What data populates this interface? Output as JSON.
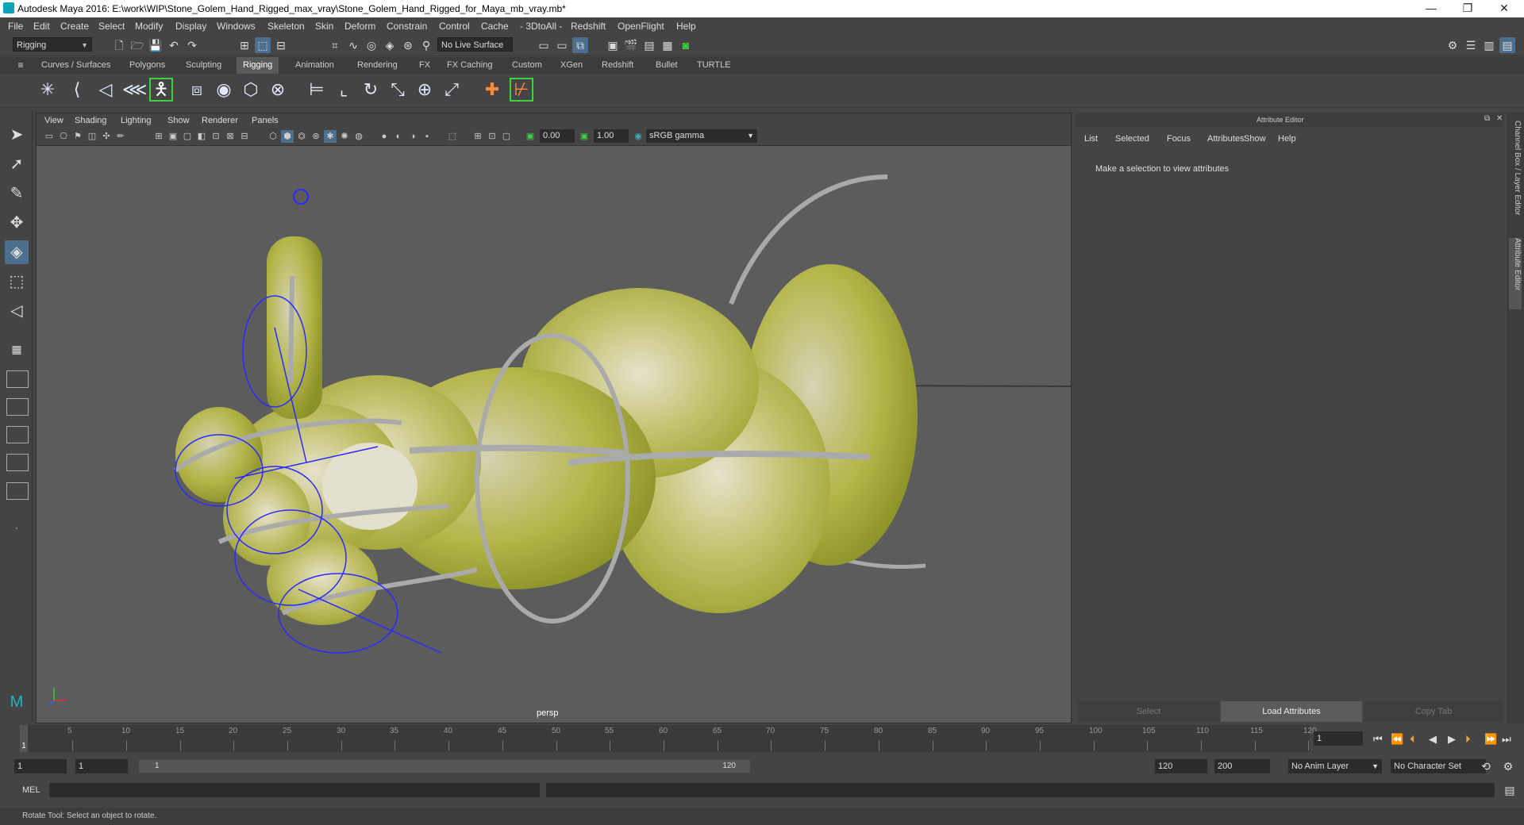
{
  "window": {
    "title": "Autodesk Maya 2016: E:\\work\\WIP\\Stone_Golem_Hand_Rigged_max_vray\\Stone_Golem_Hand_Rigged_for_Maya_mb_vray.mb*",
    "min": "—",
    "max": "❐",
    "close": "✕"
  },
  "menus": [
    "File",
    "Edit",
    "Create",
    "Select",
    "Modify",
    "Display",
    "Windows",
    "Skeleton",
    "Skin",
    "Deform",
    "Constrain",
    "Control",
    "Cache",
    "- 3DtoAll -",
    "Redshift",
    "OpenFlight",
    "Help"
  ],
  "status": {
    "menuset": "Rigging",
    "live_surface": "No Live Surface"
  },
  "shelf_tabs": [
    "Curves / Surfaces",
    "Polygons",
    "Sculpting",
    "Rigging",
    "Animation",
    "Rendering",
    "FX",
    "FX Caching",
    "Custom",
    "XGen",
    "Redshift",
    "Bullet",
    "TURTLE"
  ],
  "shelf_active": "Rigging",
  "viewport": {
    "menus": [
      "View",
      "Shading",
      "Lighting",
      "Show",
      "Renderer",
      "Panels"
    ],
    "exposure": "0.00",
    "gamma": "1.00",
    "color_space": "sRGB gamma",
    "camera_label": "persp"
  },
  "attribute_editor": {
    "title": "Attribute Editor",
    "menus": [
      "List",
      "Selected",
      "Focus",
      "Attributes",
      "Show",
      "Help"
    ],
    "message": "Make a selection to view attributes",
    "buttons": [
      "Select",
      "Load Attributes",
      "Copy Tab"
    ]
  },
  "side_tabs": [
    "Channel Box / Layer Editor",
    "Attribute Editor"
  ],
  "timeline": {
    "ticks": [
      "5",
      "10",
      "15",
      "20",
      "25",
      "30",
      "35",
      "40",
      "45",
      "50",
      "55",
      "60",
      "65",
      "70",
      "75",
      "80",
      "85",
      "90",
      "95",
      "100",
      "105",
      "110",
      "115",
      "120"
    ],
    "current_frame_marker": "1",
    "current_frame_field": "1"
  },
  "range": {
    "start": "1",
    "inner_start": "1",
    "bar_start": "1",
    "bar_end": "120",
    "end": "120",
    "outer_end": "200",
    "anim_layer": "No Anim Layer",
    "character_set": "No Character Set"
  },
  "command_line": {
    "label": "MEL"
  },
  "help_line": "Rotate Tool: Select an object to rotate."
}
